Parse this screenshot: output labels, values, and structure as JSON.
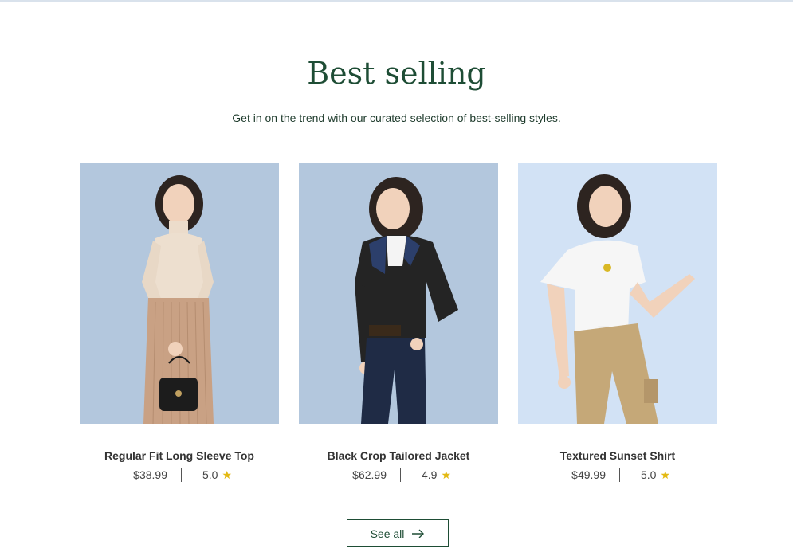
{
  "section": {
    "title": "Best selling",
    "subtitle": "Get in on the trend with our curated selection of best-selling styles."
  },
  "products": [
    {
      "name": "Regular Fit Long Sleeve Top",
      "price": "$38.99",
      "rating": "5.0",
      "image_bg": "#b3c7dd"
    },
    {
      "name": "Black Crop Tailored Jacket",
      "price": "$62.99",
      "rating": "4.9",
      "image_bg": "#b3c7dd"
    },
    {
      "name": "Textured Sunset Shirt",
      "price": "$49.99",
      "rating": "5.0",
      "image_bg": "#d2e2f5"
    }
  ],
  "see_all": {
    "label": "See all"
  },
  "icons": {
    "star": "star-icon",
    "arrow": "arrow-right-icon"
  }
}
